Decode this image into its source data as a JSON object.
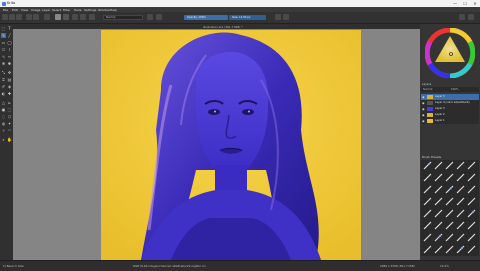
{
  "window": {
    "title": "Krita",
    "controls": [
      "—",
      "☐",
      "✕"
    ]
  },
  "menu": [
    "File",
    "Edit",
    "View",
    "Image",
    "Layer",
    "Select",
    "Filter",
    "Tools",
    "Settings",
    "Window",
    "Help"
  ],
  "toolbar": {
    "blend_mode": "Normal",
    "opacity_label": "Opacity: 100%",
    "size_label": "Size: 14.00 px"
  },
  "document": {
    "tab_title": "illustration.kra (361.7 MiB) *"
  },
  "layers": {
    "panel_title": "Layers",
    "blend_mode": "Normal",
    "opacity": "100%",
    "items": [
      {
        "name": "Layer 5",
        "active": true
      },
      {
        "name": "Layer 4 (color adjustment)",
        "active": false
      },
      {
        "name": "Layer 3",
        "active": false
      },
      {
        "name": "Layer 2",
        "active": false
      },
      {
        "name": "Layer 1",
        "active": false
      }
    ]
  },
  "brushes": {
    "panel_title": "Brush Presets"
  },
  "status": {
    "brush": "b) Basic-5 Size",
    "color_info": "RGB (8-bit integer/channel) sRGB-elle-V2-srgbtrc.icc",
    "dimensions": "2480 x 3508 (361.7 MiB)",
    "zoom": "19.4%"
  },
  "colors": {
    "canvas_bg": "#f0c93a",
    "figure": "#4a39d9",
    "hair": "#3125a6",
    "highlight": "#b790e6",
    "accent": "#3d6ea8"
  }
}
